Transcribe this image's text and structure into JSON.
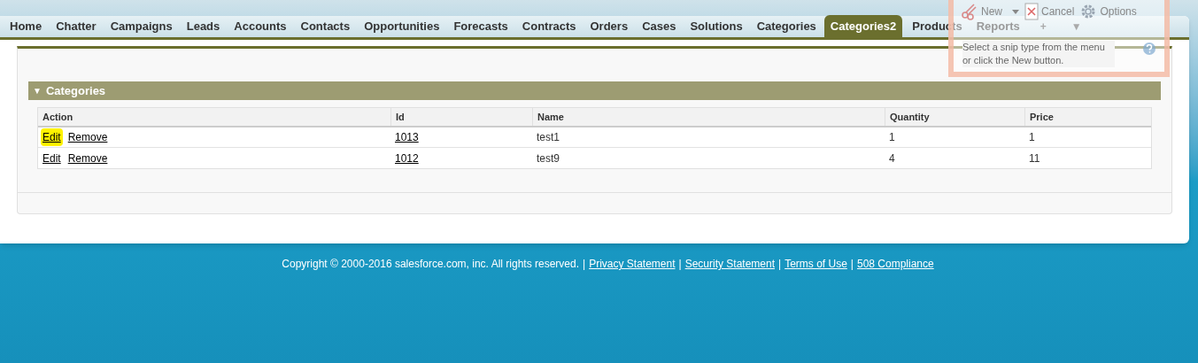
{
  "tabs": [
    {
      "label": "Home",
      "selected": false
    },
    {
      "label": "Chatter",
      "selected": false
    },
    {
      "label": "Campaigns",
      "selected": false
    },
    {
      "label": "Leads",
      "selected": false
    },
    {
      "label": "Accounts",
      "selected": false
    },
    {
      "label": "Contacts",
      "selected": false
    },
    {
      "label": "Opportunities",
      "selected": false
    },
    {
      "label": "Forecasts",
      "selected": false
    },
    {
      "label": "Contracts",
      "selected": false
    },
    {
      "label": "Orders",
      "selected": false
    },
    {
      "label": "Cases",
      "selected": false
    },
    {
      "label": "Solutions",
      "selected": false
    },
    {
      "label": "Categories",
      "selected": false
    },
    {
      "label": "Categories2",
      "selected": true
    },
    {
      "label": "Products",
      "selected": false
    },
    {
      "label": "Reports",
      "selected": false
    }
  ],
  "tab_actions": [
    "+",
    "▼"
  ],
  "section": {
    "title": "Categories",
    "toggle": "▼",
    "columns": [
      "Action",
      "Id",
      "Name",
      "Quantity",
      "Price"
    ],
    "rows": [
      {
        "edit": "Edit",
        "remove": "Remove",
        "id": "1013",
        "name": "test1",
        "quantity": "1",
        "price": "1",
        "edit_highlighted": true
      },
      {
        "edit": "Edit",
        "remove": "Remove",
        "id": "1012",
        "name": "test9",
        "quantity": "4",
        "price": "11",
        "edit_highlighted": false
      }
    ]
  },
  "footer": {
    "copyright": "Copyright © 2000-2016 salesforce.com, inc. All rights reserved.",
    "separator": "|",
    "links": [
      "Privacy Statement",
      "Security Statement",
      "Terms of Use",
      "508 Compliance"
    ]
  },
  "snip_tool": {
    "buttons": [
      {
        "label": "New",
        "kind": "new"
      },
      {
        "label": "Cancel",
        "kind": "cancel"
      },
      {
        "label": "Options",
        "kind": "options"
      }
    ],
    "hint": "Select a snip type from the menu or click the New button."
  }
}
